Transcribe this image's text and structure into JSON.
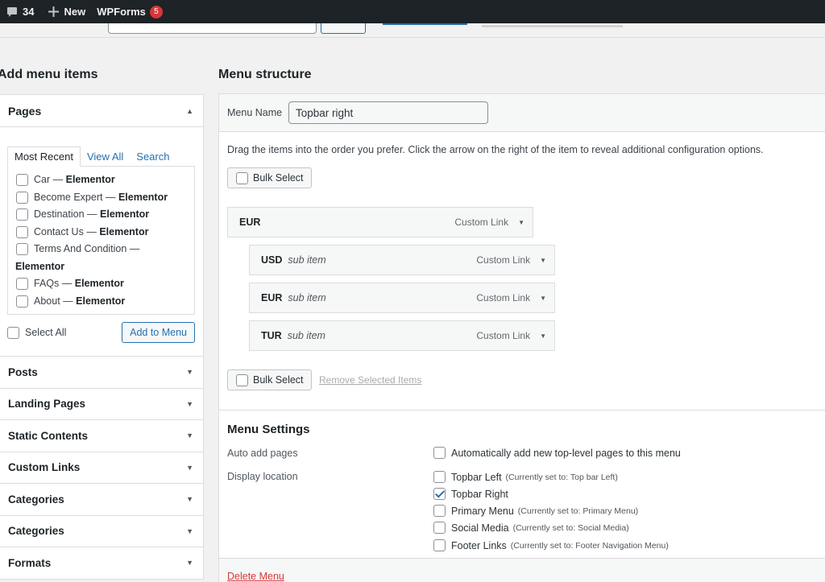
{
  "admin_bar": {
    "comments_count": "34",
    "new_label": "New",
    "wpforms_label": "WPForms",
    "wpforms_badge": "5"
  },
  "left": {
    "heading": "Add menu items",
    "pages_panel": {
      "title": "Pages",
      "tabs": [
        "Most Recent",
        "View All",
        "Search"
      ],
      "items": [
        {
          "name": "Car",
          "builder": "Elementor"
        },
        {
          "name": "Become Expert",
          "builder": "Elementor"
        },
        {
          "name": "Destination",
          "builder": "Elementor"
        },
        {
          "name": "Contact Us",
          "builder": "Elementor"
        },
        {
          "name": "Terms And Condition",
          "builder": "Elementor"
        },
        {
          "name": "FAQs",
          "builder": "Elementor"
        },
        {
          "name": "About",
          "builder": "Elementor"
        }
      ],
      "separator": "—",
      "select_all": "Select All",
      "add_button": "Add to Menu"
    },
    "closed_panels": [
      "Posts",
      "Landing Pages",
      "Static Contents",
      "Custom Links",
      "Categories",
      "Categories",
      "Formats"
    ]
  },
  "right": {
    "heading": "Menu structure",
    "menu_name_label": "Menu Name",
    "menu_name_value": "Topbar right",
    "instructions": "Drag the items into the order you prefer. Click the arrow on the right of the item to reveal additional configuration options.",
    "bulk_select": "Bulk Select",
    "remove_selected": "Remove Selected Items",
    "items": [
      {
        "title": "EUR",
        "sub": "",
        "type": "Custom Link"
      },
      {
        "title": "USD",
        "sub": "sub item",
        "type": "Custom Link"
      },
      {
        "title": "EUR",
        "sub": "sub item",
        "type": "Custom Link"
      },
      {
        "title": "TUR",
        "sub": "sub item",
        "type": "Custom Link"
      }
    ],
    "settings": {
      "title": "Menu Settings",
      "auto_add_label": "Auto add pages",
      "auto_add_option": "Automatically add new top-level pages to this menu",
      "display_location_label": "Display location",
      "locations": [
        {
          "name": "Topbar Left",
          "note": "(Currently set to: Top bar Left)",
          "checked": false
        },
        {
          "name": "Topbar Right",
          "note": "",
          "checked": true
        },
        {
          "name": "Primary Menu",
          "note": "(Currently set to: Primary Menu)",
          "checked": false
        },
        {
          "name": "Social Media",
          "note": "(Currently set to: Social Media)",
          "checked": false
        },
        {
          "name": "Footer Links",
          "note": "(Currently set to: Footer Navigation Menu)",
          "checked": false
        }
      ]
    },
    "delete_menu": "Delete Menu"
  }
}
